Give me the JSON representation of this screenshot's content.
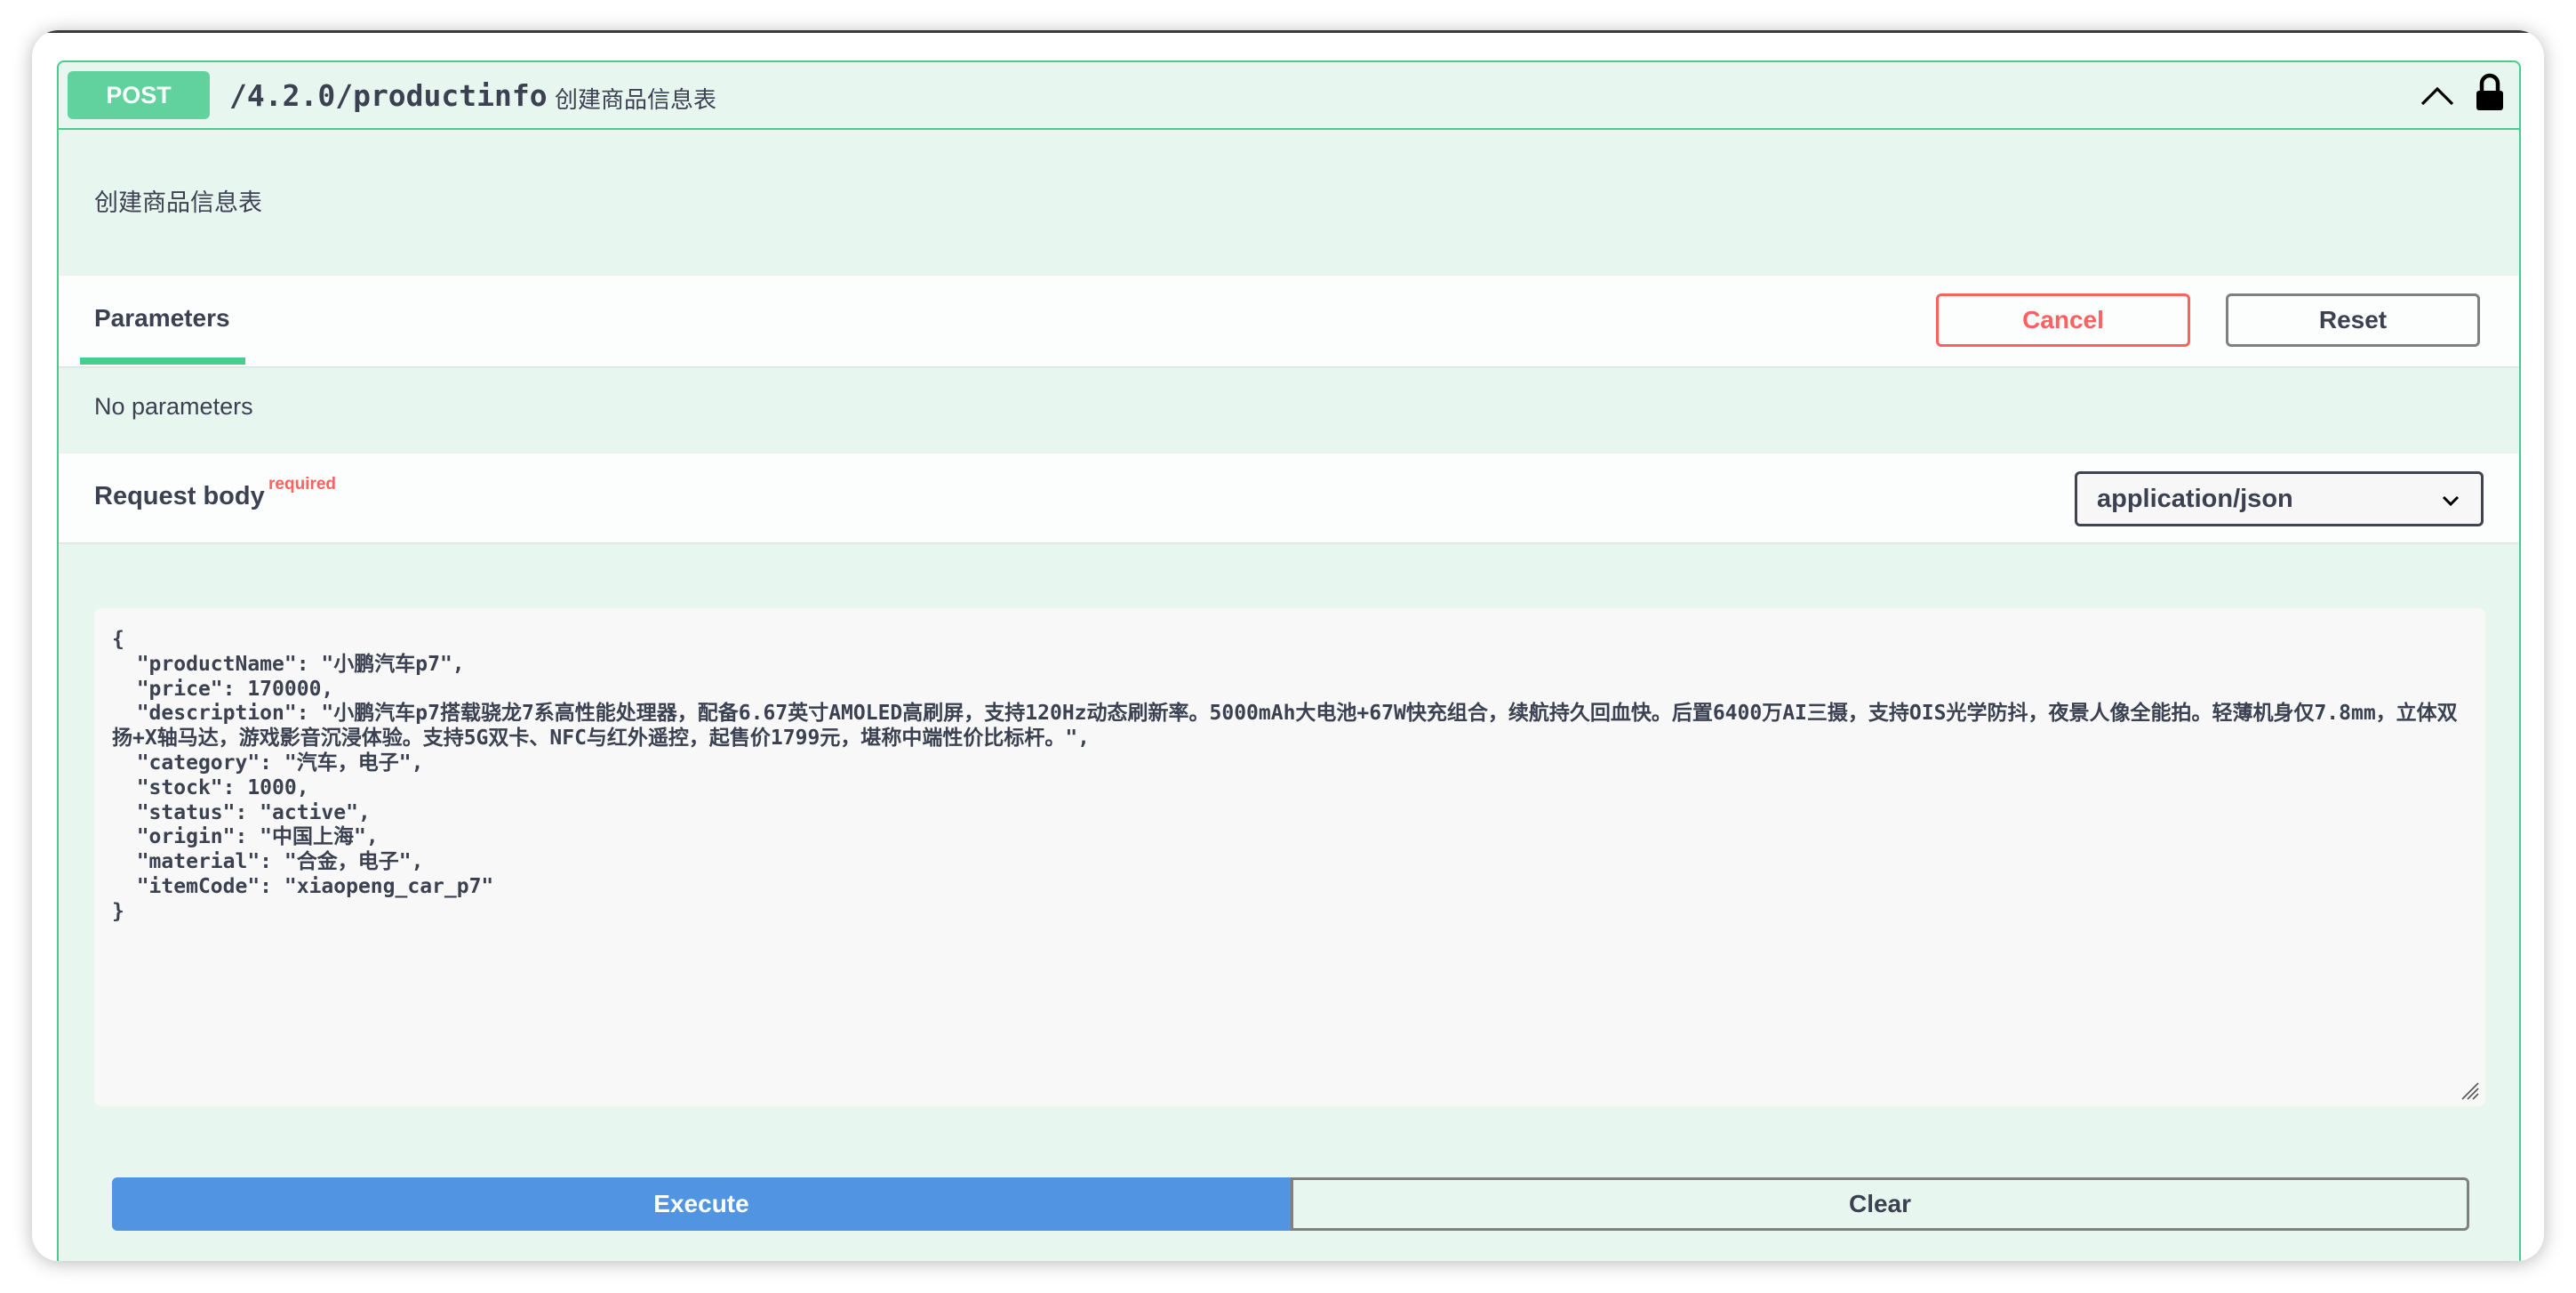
{
  "operation": {
    "method": "POST",
    "path": "/4.2.0/productinfo",
    "summary": "创建商品信息表",
    "description": "创建商品信息表"
  },
  "parameters": {
    "tab_label": "Parameters",
    "cancel_label": "Cancel",
    "reset_label": "Reset",
    "empty_text": "No parameters"
  },
  "request_body": {
    "label": "Request body",
    "required_flag": "required",
    "content_type": "application/json",
    "value": "{\n  \"productName\": \"小鹏汽车p7\",\n  \"price\": 170000,\n  \"description\": \"小鹏汽车p7搭载骁龙7系高性能处理器，配备6.67英寸AMOLED高刷屏，支持120Hz动态刷新率。5000mAh大电池+67W快充组合，续航持久回血快。后置6400万AI三摄，支持OIS光学防抖，夜景人像全能拍。轻薄机身仅7.8mm，立体双扬+X轴马达，游戏影音沉浸体验。支持5G双卡、NFC与红外遥控，起售价1799元，堪称中端性价比标杆。\",\n  \"category\": \"汽车，电子\",\n  \"stock\": 1000,\n  \"status\": \"active\",\n  \"origin\": \"中国上海\",\n  \"material\": \"合金，电子\",\n  \"itemCode\": \"xiaopeng_car_p7\"\n}"
  },
  "actions": {
    "execute_label": "Execute",
    "clear_label": "Clear"
  },
  "colors": {
    "post": "#49cc90",
    "execute": "#4990e2",
    "cancel": "#ff6060"
  },
  "icons": [
    "chevron-up-icon",
    "lock-icon",
    "chevron-down-icon",
    "resize-handle-icon"
  ]
}
